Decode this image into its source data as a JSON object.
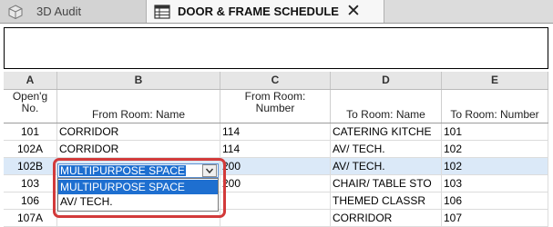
{
  "tabs": [
    {
      "label": "3D Audit",
      "icon": "3d-view-icon",
      "active": false
    },
    {
      "label": "DOOR & FRAME SCHEDULE",
      "icon": "schedule-icon",
      "active": true,
      "close": "✕"
    }
  ],
  "schedule": {
    "column_letters": [
      "A",
      "B",
      "C",
      "D",
      "E"
    ],
    "headers": {
      "a_line1": "Open'g",
      "a_line2": "No.",
      "b": "From Room: Name",
      "c_line1": "From Room:",
      "c_line2": "Number",
      "d": "To Room: Name",
      "e": "To Room: Number"
    },
    "rows": [
      {
        "open": "101",
        "from_name": "CORRIDOR",
        "from_num": "114",
        "to_name": "CATERING KITCHE",
        "to_num": "101"
      },
      {
        "open": "102A",
        "from_name": "CORRIDOR",
        "from_num": "114",
        "to_name": "AV/ TECH.",
        "to_num": "102"
      },
      {
        "open": "102B",
        "from_name": "",
        "from_num": "200",
        "to_name": "AV/ TECH.",
        "to_num": "102"
      },
      {
        "open": "103",
        "from_name": "",
        "from_num": "200",
        "to_name": "CHAIR/ TABLE STO",
        "to_num": "103"
      },
      {
        "open": "106",
        "from_name": "",
        "from_num": "",
        "to_name": "THEMED CLASSR",
        "to_num": "106"
      },
      {
        "open": "107A",
        "from_name": "",
        "from_num": "",
        "to_name": "CORRIDOR",
        "to_num": "107"
      }
    ]
  },
  "editor": {
    "selected_value": "MULTIPURPOSE SPACE",
    "options": [
      "MULTIPURPOSE SPACE",
      "AV/ TECH."
    ]
  },
  "colors": {
    "selection_blue": "#1e6fd0",
    "annotation_red": "#d23a3a",
    "selected_row": "#dbe9f8"
  }
}
